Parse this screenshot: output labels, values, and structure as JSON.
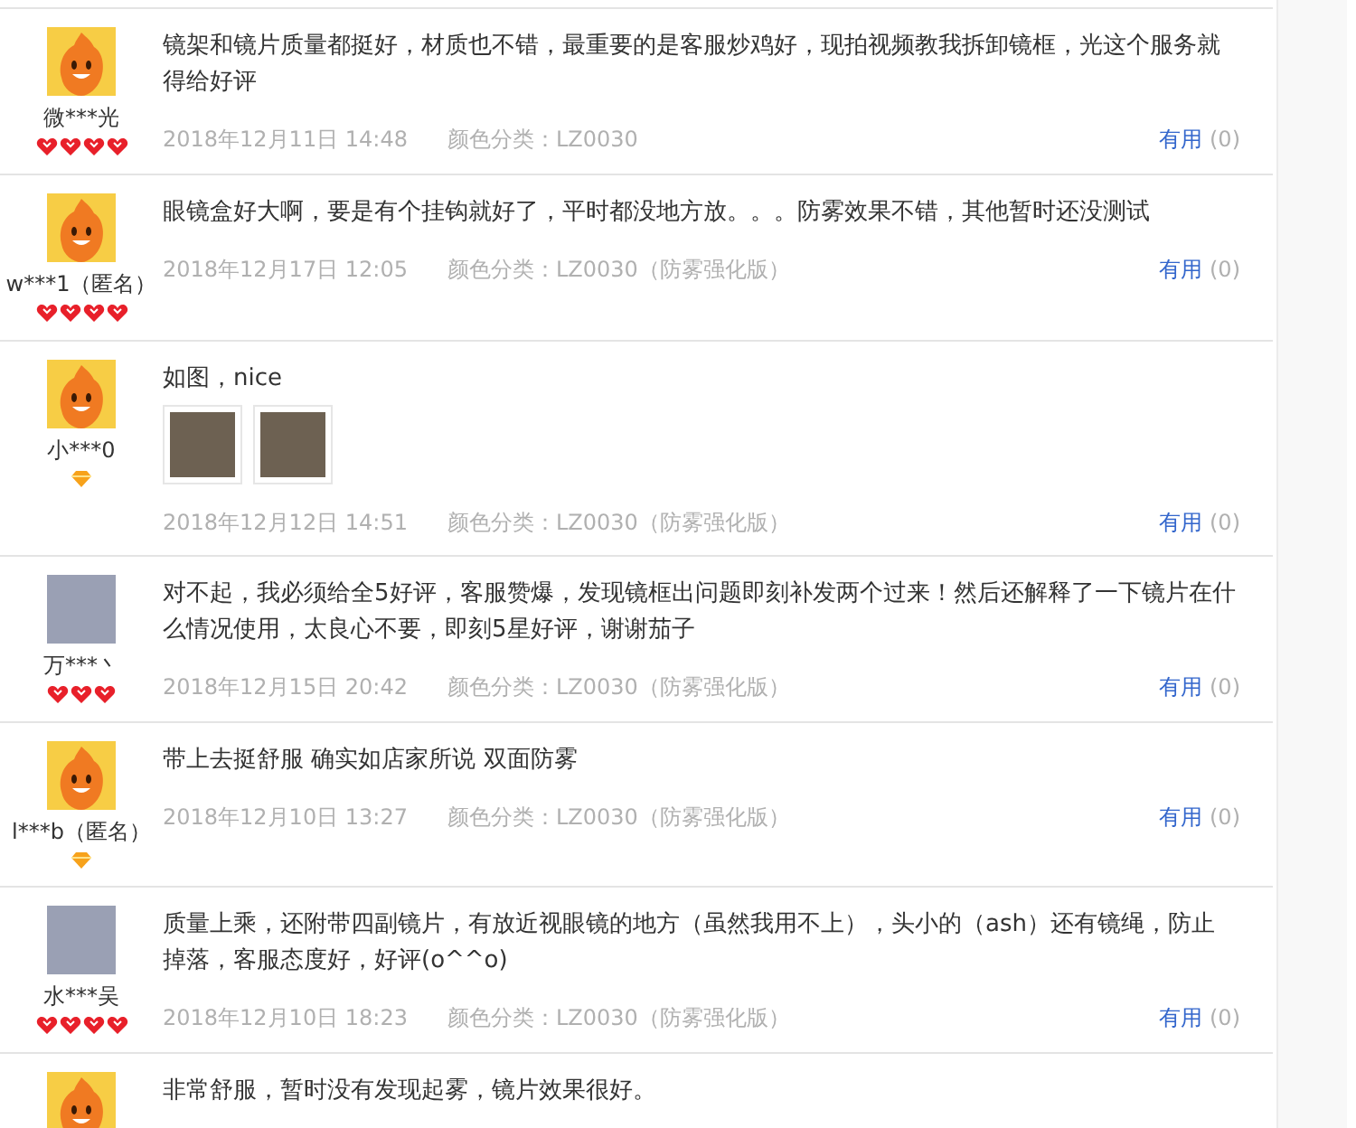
{
  "reviews": [
    {
      "avatar": {
        "kind": "mascot"
      },
      "user": "微***光",
      "rank": {
        "kind": "heart",
        "stars": 4
      },
      "text": "镜架和镜片质量都挺好，材质也不错，最重要的是客服炒鸡好，现拍视频教我拆卸镜框，光这个服务就得给好评",
      "date": "2018年12月11日 14:48",
      "variant": "颜色分类：LZ0030",
      "useful_label": "有用",
      "useful_count": "(0)"
    },
    {
      "avatar": {
        "kind": "mascot"
      },
      "user": "w***1（匿名）",
      "rank": {
        "kind": "heart",
        "stars": 4
      },
      "text": "眼镜盒好大啊，要是有个挂钩就好了，平时都没地方放。。。防雾效果不错，其他暂时还没测试",
      "date": "2018年12月17日 12:05",
      "variant": "颜色分类：LZ0030（防雾强化版）",
      "useful_label": "有用",
      "useful_count": "(0)"
    },
    {
      "avatar": {
        "kind": "mascot"
      },
      "user": "小***0",
      "rank": {
        "kind": "diamond"
      },
      "text": "如图，nice",
      "photos": [
        {
          "kind": "photo"
        },
        {
          "kind": "photo"
        }
      ],
      "date": "2018年12月12日 14:51",
      "variant": "颜色分类：LZ0030（防雾强化版）",
      "useful_label": "有用",
      "useful_count": "(0)"
    },
    {
      "avatar": {
        "kind": "picture"
      },
      "user": "万***丶",
      "rank": {
        "kind": "heart",
        "stars": 3
      },
      "text": "对不起，我必须给全5好评，客服赞爆，发现镜框出问题即刻补发两个过来！然后还解释了一下镜片在什么情况使用，太良心不要，即刻5星好评，谢谢茄子",
      "date": "2018年12月15日 20:42",
      "variant": "颜色分类：LZ0030（防雾强化版）",
      "useful_label": "有用",
      "useful_count": "(0)"
    },
    {
      "avatar": {
        "kind": "mascot"
      },
      "user": "l***b（匿名）",
      "rank": {
        "kind": "diamond"
      },
      "text": "带上去挺舒服 确实如店家所说 双面防雾",
      "date": "2018年12月10日 13:27",
      "variant": "颜色分类：LZ0030（防雾强化版）",
      "useful_label": "有用",
      "useful_count": "(0)"
    },
    {
      "avatar": {
        "kind": "picture"
      },
      "user": "水***吴",
      "rank": {
        "kind": "heart",
        "stars": 4
      },
      "text": "质量上乘，还附带四副镜片，有放近视眼镜的地方（虽然我用不上），头小的（ash）还有镜绳，防止掉落，客服态度好，好评(o^^o)",
      "date": "2018年12月10日 18:23",
      "variant": "颜色分类：LZ0030（防雾强化版）",
      "useful_label": "有用",
      "useful_count": "(0)"
    },
    {
      "avatar": {
        "kind": "mascot"
      },
      "text": "非常舒服，暂时没有发现起雾，镜片效果很好。"
    }
  ]
}
